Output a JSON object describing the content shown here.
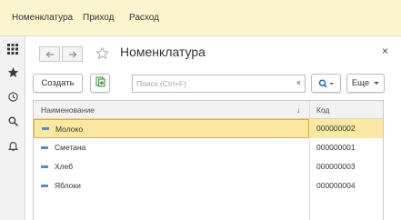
{
  "top_menu": {
    "items": [
      "Номенклатура",
      "Приход",
      "Расход"
    ]
  },
  "left_panel": {
    "icons": [
      "apps-grid-icon",
      "favorites-star-icon",
      "history-icon",
      "search-icon",
      "notifications-bell-icon"
    ]
  },
  "form": {
    "title": "Номенклатура",
    "back_label": "←",
    "forward_label": "→",
    "close_label": "×"
  },
  "toolbar": {
    "create_label": "Создать",
    "search_placeholder": "Поиск (Ctrl+F)",
    "clear_label": "×",
    "more_label": "Еще"
  },
  "table": {
    "columns": [
      "Наименование",
      "Код"
    ],
    "sort_indicator": "↓",
    "rows": [
      {
        "name": "Молоко",
        "code": "000000002",
        "selected": true
      },
      {
        "name": "Сметана",
        "code": "000000001",
        "selected": false
      },
      {
        "name": "Хлеб",
        "code": "000000003",
        "selected": false
      },
      {
        "name": "Яблоки",
        "code": "000000004",
        "selected": false
      }
    ]
  },
  "colors": {
    "topbar_bg": "#fbf5cf",
    "selection_bg": "#fbe9a3",
    "selection_border": "#e1ae3b",
    "row_mark": "#5e86c4"
  }
}
